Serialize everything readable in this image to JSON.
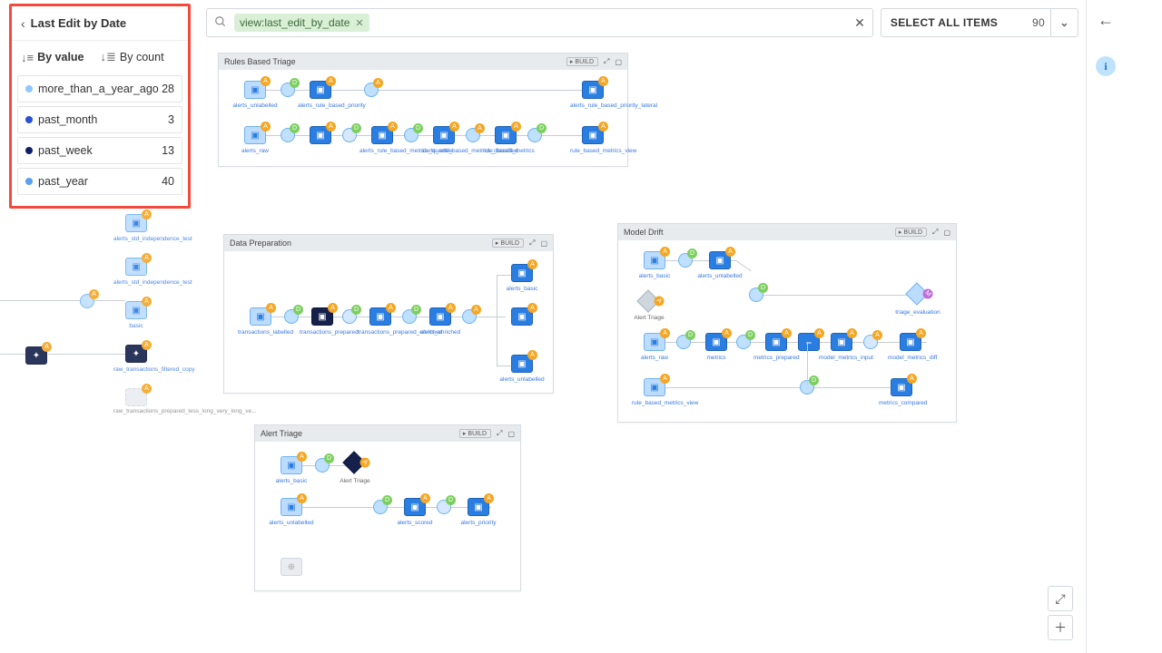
{
  "panel": {
    "title": "Last Edit by Date",
    "sort_by_value": "By value",
    "sort_by_count": "By count",
    "items": [
      {
        "label": "more_than_a_year_ago",
        "count": 28,
        "color": "#8fc7ff"
      },
      {
        "label": "past_month",
        "count": 3,
        "color": "#2851d8"
      },
      {
        "label": "past_week",
        "count": 13,
        "color": "#0f1e66"
      },
      {
        "label": "past_year",
        "count": 40,
        "color": "#5aa0ef"
      }
    ]
  },
  "search": {
    "chip_text": "view:last_edit_by_date"
  },
  "select_all": {
    "label": "SELECT ALL ITEMS",
    "count": 90
  },
  "zones": [
    {
      "title": "Rules Based Triage",
      "build": "BUILD"
    },
    {
      "title": "Data Preparation",
      "build": "BUILD"
    },
    {
      "title": "Model Drift",
      "build": "BUILD"
    },
    {
      "title": "Alert Triage",
      "build": "BUILD"
    }
  ],
  "node_labels": {
    "rbt": [
      "alerts_unlabelled",
      "alerts_rule_based_priority",
      "",
      "alerts_rule_based_priority_lateral",
      "alerts_raw",
      "",
      "alerts_rule_based_metrics_quantile",
      "",
      "alerts_rule_based_metrics_classified",
      "",
      "rule_based_metrics",
      "",
      "rule_based_metrics_view"
    ],
    "dp": [
      "transactions_labelled",
      "",
      "transactions_prepared",
      "",
      "transactions_prepared_enriched",
      "",
      "alerts_enriched",
      "alerts_basic",
      "alerts_unlabelled"
    ],
    "md": [
      "alerts_basic",
      "",
      "alerts_unlabelled",
      "Alert Triage",
      "alerts_raw",
      "",
      "metrics",
      "",
      "metrics_prepared",
      "",
      "model_metrics_input",
      "",
      "model_metrics_diff",
      "rule_based_metrics_view",
      "",
      "metrics_compared",
      "triage_evaluation"
    ],
    "at": [
      "alerts_basic",
      "",
      "Alert Triage",
      "alerts_unlabelled",
      "",
      "alerts_scored",
      "",
      "alerts_priority"
    ]
  },
  "ghost_labels": [
    "alerts_std_independence_test",
    "alerts_std_independence_test",
    "basic",
    "raw_transactions_filtered_copy",
    "raw_transactions_prepared_less_long_very_long_ve..."
  ]
}
